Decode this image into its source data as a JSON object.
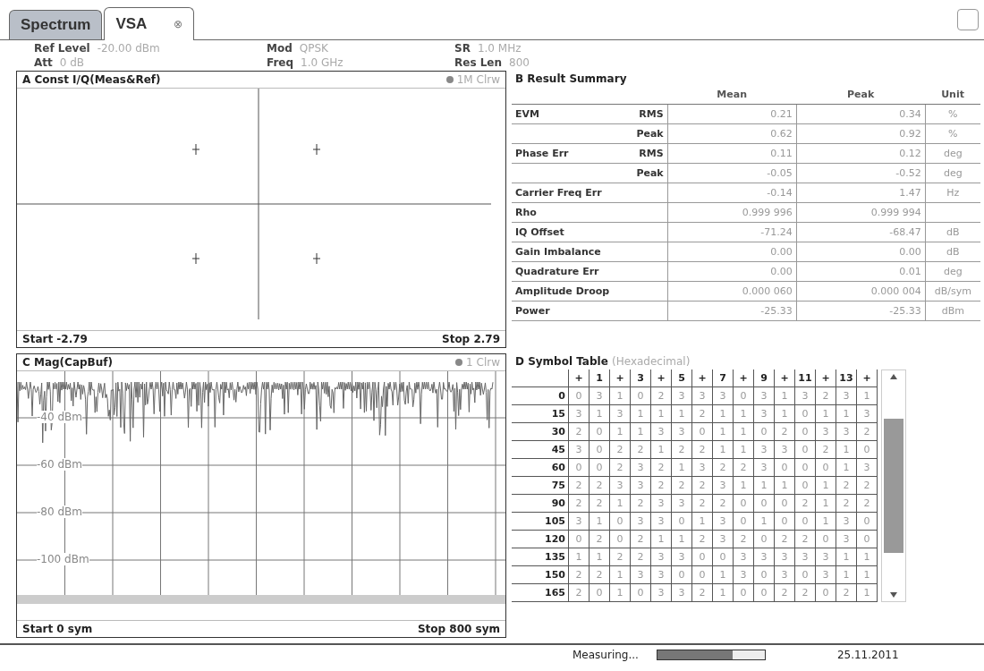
{
  "tabs": [
    {
      "label": "Spectrum",
      "selected": false
    },
    {
      "label": "VSA",
      "selected": true,
      "close": "⊗"
    }
  ],
  "settings": [
    {
      "label": "Ref Level",
      "value": "-20.00 dBm"
    },
    {
      "label": "Mod",
      "value": "QPSK"
    },
    {
      "label": "SR",
      "value": "1.0 MHz"
    },
    {
      "label": "Att",
      "value": "0 dB"
    },
    {
      "label": "Freq",
      "value": "1.0 GHz"
    },
    {
      "label": "Res Len",
      "value": "800"
    }
  ],
  "constellation": {
    "title": "A Const I/Q(Meas&Ref)",
    "trace": "1M Clrw",
    "start": "Start -2.79",
    "stop": "Stop 2.79"
  },
  "magnitude": {
    "title": "C Mag(CapBuf)",
    "trace": "1 Clrw",
    "y_labels": [
      "-40 dBm",
      "-60 dBm",
      "-80 dBm",
      "-100 dBm"
    ],
    "start": "Start 0 sym",
    "stop": "Stop 800 sym"
  },
  "result_summary": {
    "title": "B Result Summary",
    "columns": [
      "Mean",
      "Peak",
      "Unit"
    ],
    "rows": [
      {
        "label": "EVM",
        "sub": "RMS",
        "mean": "0.21",
        "peak": "0.34",
        "unit": "%"
      },
      {
        "label": "",
        "sub": "Peak",
        "mean": "0.62",
        "peak": "0.92",
        "unit": "%"
      },
      {
        "label": "Phase Err",
        "sub": "RMS",
        "mean": "0.11",
        "peak": "0.12",
        "unit": "deg"
      },
      {
        "label": "",
        "sub": "Peak",
        "mean": "-0.05",
        "peak": "-0.52",
        "unit": "deg"
      },
      {
        "label": "Carrier Freq Err",
        "sub": "",
        "mean": "-0.14",
        "peak": "1.47",
        "unit": "Hz"
      },
      {
        "label": "Rho",
        "sub": "",
        "mean": "0.999 996",
        "peak": "0.999 994",
        "unit": ""
      },
      {
        "label": "IQ Offset",
        "sub": "",
        "mean": "-71.24",
        "peak": "-68.47",
        "unit": "dB"
      },
      {
        "label": "Gain Imbalance",
        "sub": "",
        "mean": "0.00",
        "peak": "0.00",
        "unit": "dB"
      },
      {
        "label": "Quadrature Err",
        "sub": "",
        "mean": "0.00",
        "peak": "0.01",
        "unit": "deg"
      },
      {
        "label": "Amplitude Droop",
        "sub": "",
        "mean": "0.000 060",
        "peak": "0.000 004",
        "unit": "dB/sym"
      },
      {
        "label": "Power",
        "sub": "",
        "mean": "-25.33",
        "peak": "-25.33",
        "unit": "dBm"
      }
    ]
  },
  "symbol_table": {
    "title": "D Symbol Table",
    "subtitle": "(Hexadecimal)",
    "columns": [
      "+",
      "1",
      "+",
      "3",
      "+",
      "5",
      "+",
      "7",
      "+",
      "9",
      "+",
      "11",
      "+",
      "13",
      "+"
    ],
    "rows": [
      {
        "label": "0",
        "values": [
          "0",
          "3",
          "1",
          "0",
          "2",
          "3",
          "3",
          "3",
          "0",
          "3",
          "1",
          "3",
          "2",
          "3",
          "1"
        ]
      },
      {
        "label": "15",
        "values": [
          "3",
          "1",
          "3",
          "1",
          "1",
          "1",
          "2",
          "1",
          "1",
          "3",
          "1",
          "0",
          "1",
          "1",
          "3"
        ]
      },
      {
        "label": "30",
        "values": [
          "2",
          "0",
          "1",
          "1",
          "3",
          "3",
          "0",
          "1",
          "1",
          "0",
          "2",
          "0",
          "3",
          "3",
          "2"
        ]
      },
      {
        "label": "45",
        "values": [
          "3",
          "0",
          "2",
          "2",
          "1",
          "2",
          "2",
          "1",
          "1",
          "3",
          "3",
          "0",
          "2",
          "1",
          "0"
        ]
      },
      {
        "label": "60",
        "values": [
          "0",
          "0",
          "2",
          "3",
          "2",
          "1",
          "3",
          "2",
          "2",
          "3",
          "0",
          "0",
          "0",
          "1",
          "3"
        ]
      },
      {
        "label": "75",
        "values": [
          "2",
          "2",
          "3",
          "3",
          "2",
          "2",
          "2",
          "3",
          "1",
          "1",
          "1",
          "0",
          "1",
          "2",
          "2"
        ]
      },
      {
        "label": "90",
        "values": [
          "2",
          "2",
          "1",
          "2",
          "3",
          "3",
          "2",
          "2",
          "0",
          "0",
          "0",
          "2",
          "1",
          "2",
          "2"
        ]
      },
      {
        "label": "105",
        "values": [
          "3",
          "1",
          "0",
          "3",
          "3",
          "0",
          "1",
          "3",
          "0",
          "1",
          "0",
          "0",
          "1",
          "3",
          "0"
        ]
      },
      {
        "label": "120",
        "values": [
          "0",
          "2",
          "0",
          "2",
          "1",
          "1",
          "2",
          "3",
          "2",
          "0",
          "2",
          "2",
          "0",
          "3",
          "0"
        ]
      },
      {
        "label": "135",
        "values": [
          "1",
          "1",
          "2",
          "2",
          "3",
          "3",
          "0",
          "0",
          "3",
          "3",
          "3",
          "3",
          "3",
          "1",
          "1"
        ]
      },
      {
        "label": "150",
        "values": [
          "2",
          "2",
          "1",
          "3",
          "3",
          "0",
          "0",
          "1",
          "3",
          "0",
          "3",
          "0",
          "3",
          "1",
          "1"
        ]
      },
      {
        "label": "165",
        "values": [
          "2",
          "0",
          "1",
          "0",
          "3",
          "3",
          "2",
          "1",
          "0",
          "0",
          "2",
          "2",
          "0",
          "2",
          "1"
        ]
      }
    ]
  },
  "status": {
    "text": "Measuring...",
    "level": 0.7,
    "date": "25.11.2011"
  }
}
